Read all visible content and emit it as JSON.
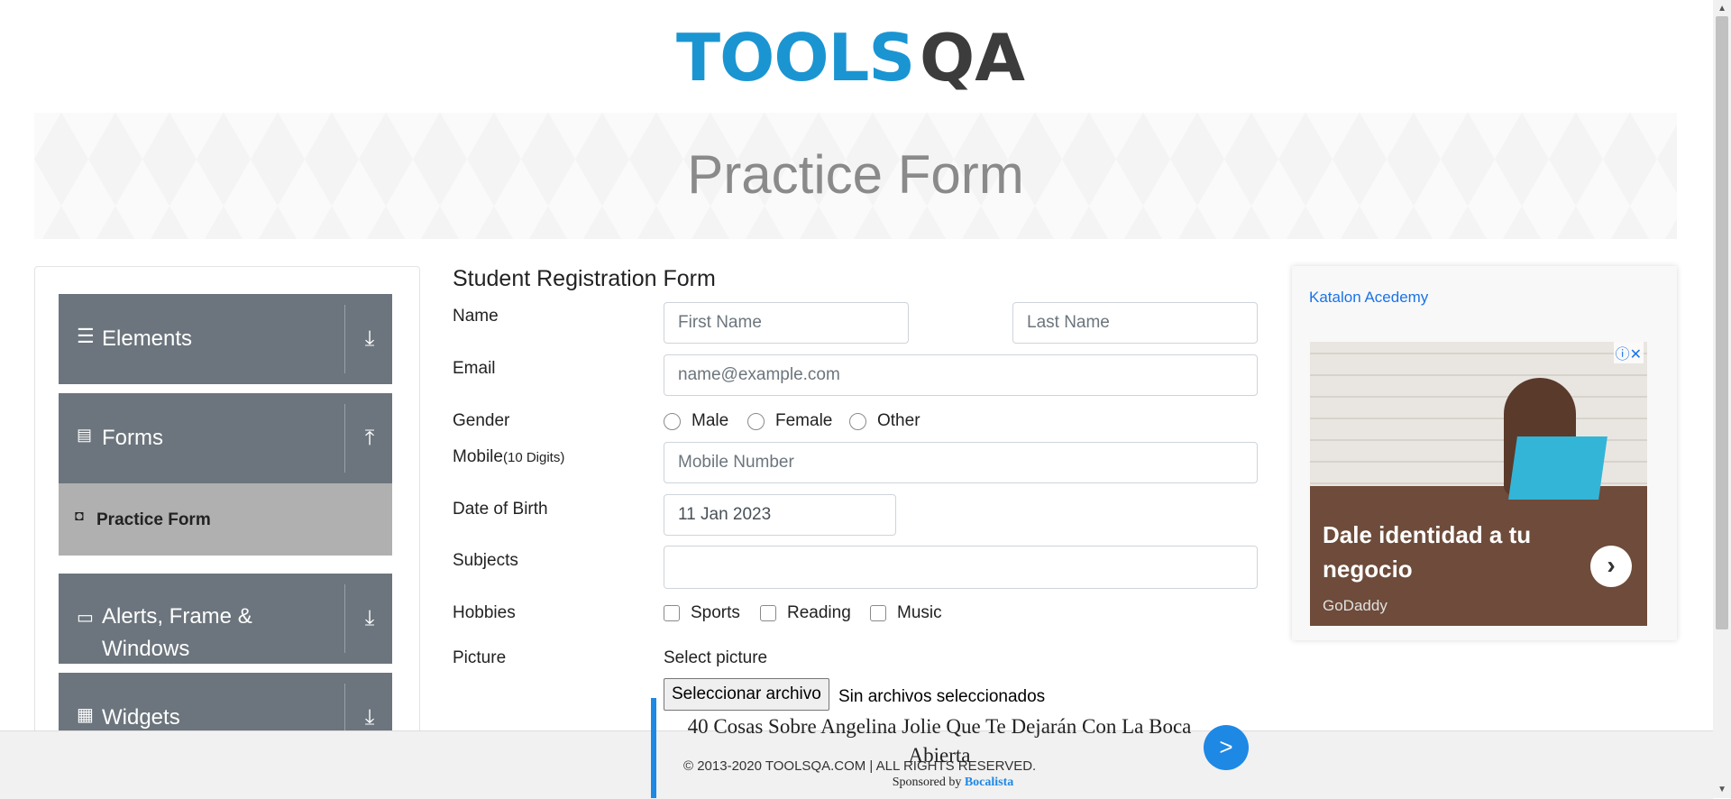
{
  "header": {
    "logo_word": "TOOLS",
    "logo_qa": "QA"
  },
  "banner": {
    "title": "Practice Form"
  },
  "sidebar": {
    "groups": [
      {
        "label": "Elements",
        "icon": "hamburger-icon",
        "arrow": "download-arrow"
      },
      {
        "label": "Forms",
        "icon": "document-icon",
        "arrow": "upload-arrow"
      },
      {
        "label": "Alerts, Frame & Windows",
        "icon": "window-icon",
        "arrow": "download-arrow"
      },
      {
        "label": "Widgets",
        "icon": "widgets-icon",
        "arrow": "download-arrow"
      }
    ],
    "active_item": {
      "label": "Practice Form",
      "icon": "html5-icon"
    }
  },
  "form": {
    "title": "Student Registration Form",
    "name_label": "Name",
    "first_name_placeholder": "First Name",
    "last_name_placeholder": "Last Name",
    "email_label": "Email",
    "email_placeholder": "name@example.com",
    "gender_label": "Gender",
    "gender_options": [
      "Male",
      "Female",
      "Other"
    ],
    "mobile_label": "Mobile",
    "mobile_hint": "(10 Digits)",
    "mobile_placeholder": "Mobile Number",
    "dob_label": "Date of Birth",
    "dob_value": "11 Jan 2023",
    "subjects_label": "Subjects",
    "hobbies_label": "Hobbies",
    "hobby_options": [
      "Sports",
      "Reading",
      "Music"
    ],
    "picture_label": "Picture",
    "select_picture_label": "Select picture",
    "file_button": "Seleccionar archivo",
    "file_status": "Sin archivos seleccionados"
  },
  "ad": {
    "link_text": "Katalon Acedemy",
    "headline": "Dale identidad a tu negocio",
    "brand": "GoDaddy",
    "info": "ⓘ✕"
  },
  "footer": {
    "copyright": "© 2013-2020 TOOLSQA.COM | ALL RIGHTS RESERVED."
  },
  "floating_ad": {
    "title": "40 Cosas Sobre Angelina Jolie Que Te Dejarán Con La Boca Abierta",
    "sponsored_by": "Sponsored by",
    "sponsor_name": "Bocalista",
    "go_label": ">"
  },
  "colors": {
    "accent": "#1a95d2",
    "sidebar_group": "#6c757d",
    "sidebar_active": "#b0b0b0",
    "float_accent": "#1e88e5"
  }
}
